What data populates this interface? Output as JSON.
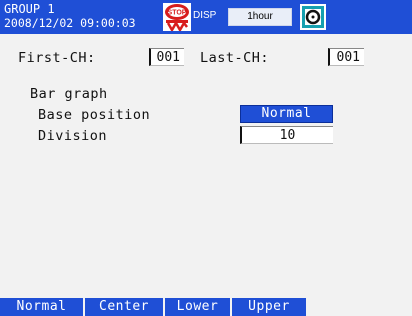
{
  "header": {
    "group": "GROUP 1",
    "datetime": "2008/12/02 09:00:03",
    "stop_icon": "stop-icon",
    "disp_label": "DISP",
    "rate": "1hour",
    "media_icon": "media-icon",
    "bg_color": "#1f4fd6"
  },
  "channels": {
    "first_label": "First-CH:",
    "first_value": "001",
    "last_label": "Last-CH:",
    "last_value": "001"
  },
  "bargraph": {
    "section_label": "Bar graph",
    "base_position_label": "Base position",
    "base_position_value": "Normal",
    "division_label": "Division",
    "division_value": "10"
  },
  "softkeys": [
    "Normal",
    "Center",
    "Lower",
    "Upper"
  ],
  "colors": {
    "accent": "#1f4fd6",
    "background": "#f2f2f2"
  }
}
